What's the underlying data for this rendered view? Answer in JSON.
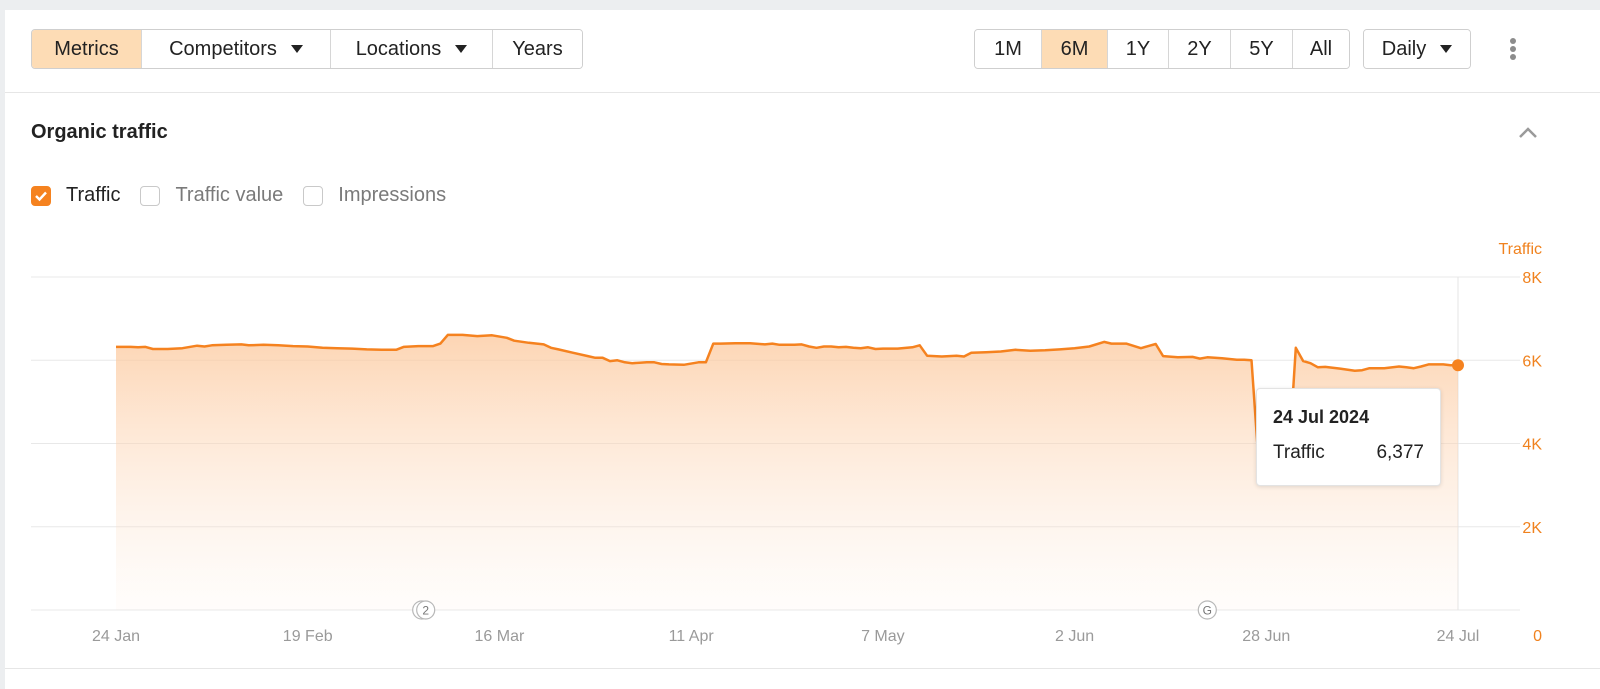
{
  "toolbar": {
    "left_tabs": [
      {
        "label": "Metrics",
        "active": true,
        "dropdown": false
      },
      {
        "label": "Competitors",
        "active": false,
        "dropdown": true
      },
      {
        "label": "Locations",
        "active": false,
        "dropdown": true
      },
      {
        "label": "Years",
        "active": false,
        "dropdown": false
      }
    ],
    "ranges": [
      {
        "label": "1M",
        "active": false
      },
      {
        "label": "6M",
        "active": true
      },
      {
        "label": "1Y",
        "active": false
      },
      {
        "label": "2Y",
        "active": false
      },
      {
        "label": "5Y",
        "active": false
      },
      {
        "label": "All",
        "active": false
      }
    ],
    "granularity": "Daily",
    "more_icon": "kebab-vertical-icon"
  },
  "section": {
    "title": "Organic traffic",
    "collapse_icon": "chevron-up-icon"
  },
  "legend": [
    {
      "label": "Traffic",
      "checked": true
    },
    {
      "label": "Traffic value",
      "checked": false
    },
    {
      "label": "Impressions",
      "checked": false
    }
  ],
  "tooltip": {
    "date": "24 Jul 2024",
    "metric": "Traffic",
    "value": "6,377"
  },
  "colors": {
    "accent": "#f5821f",
    "active_tab": "#fddcb5",
    "axis_label": "#f0821e"
  },
  "chart_data": {
    "type": "area",
    "title": "Organic traffic",
    "ylabel": "Traffic",
    "ylim": [
      0,
      8000
    ],
    "yticks": [
      {
        "value": 8000,
        "label": "8K"
      },
      {
        "value": 6000,
        "label": "6K"
      },
      {
        "value": 4000,
        "label": "4K"
      },
      {
        "value": 2000,
        "label": "2K"
      },
      {
        "value": 0,
        "label": "0"
      }
    ],
    "xrange_days": [
      0,
      182
    ],
    "xticks": [
      {
        "day": 0,
        "label": "24 Jan"
      },
      {
        "day": 26,
        "label": "19 Feb"
      },
      {
        "day": 52,
        "label": "16 Mar"
      },
      {
        "day": 78,
        "label": "11 Apr"
      },
      {
        "day": 104,
        "label": "7 May"
      },
      {
        "day": 130,
        "label": "2 Jun"
      },
      {
        "day": 156,
        "label": "28 Jun"
      },
      {
        "day": 182,
        "label": "24 Jul"
      }
    ],
    "annotations": [
      {
        "day": 42,
        "label": "2",
        "kind": "multiple-events"
      },
      {
        "day": 148,
        "label": "G",
        "kind": "google-update"
      }
    ],
    "grid": true,
    "legend": "top-left",
    "series": [
      {
        "name": "Traffic",
        "points": [
          [
            0,
            6320
          ],
          [
            2,
            6320
          ],
          [
            3,
            6310
          ],
          [
            4,
            6320
          ],
          [
            5,
            6270
          ],
          [
            7,
            6270
          ],
          [
            9,
            6290
          ],
          [
            11,
            6350
          ],
          [
            12,
            6330
          ],
          [
            13,
            6360
          ],
          [
            15,
            6370
          ],
          [
            17,
            6380
          ],
          [
            18,
            6360
          ],
          [
            20,
            6370
          ],
          [
            22,
            6360
          ],
          [
            24,
            6340
          ],
          [
            26,
            6330
          ],
          [
            28,
            6300
          ],
          [
            30,
            6290
          ],
          [
            32,
            6280
          ],
          [
            34,
            6260
          ],
          [
            36,
            6250
          ],
          [
            38,
            6250
          ],
          [
            39,
            6320
          ],
          [
            41,
            6340
          ],
          [
            43,
            6340
          ],
          [
            44,
            6400
          ],
          [
            45,
            6610
          ],
          [
            47,
            6610
          ],
          [
            49,
            6580
          ],
          [
            51,
            6600
          ],
          [
            53,
            6540
          ],
          [
            54,
            6470
          ],
          [
            56,
            6420
          ],
          [
            58,
            6380
          ],
          [
            59,
            6300
          ],
          [
            60,
            6260
          ],
          [
            62,
            6180
          ],
          [
            64,
            6100
          ],
          [
            65,
            6060
          ],
          [
            66,
            6060
          ],
          [
            67,
            5980
          ],
          [
            68,
            6000
          ],
          [
            69,
            5950
          ],
          [
            70,
            5930
          ],
          [
            71,
            5940
          ],
          [
            72,
            5950
          ],
          [
            73,
            5950
          ],
          [
            74,
            5910
          ],
          [
            75,
            5900
          ],
          [
            77,
            5890
          ],
          [
            79,
            5950
          ],
          [
            80,
            5950
          ],
          [
            81,
            6400
          ],
          [
            82,
            6400
          ],
          [
            84,
            6410
          ],
          [
            86,
            6410
          ],
          [
            88,
            6380
          ],
          [
            89,
            6400
          ],
          [
            90,
            6370
          ],
          [
            92,
            6370
          ],
          [
            93,
            6380
          ],
          [
            94,
            6330
          ],
          [
            95,
            6300
          ],
          [
            96,
            6330
          ],
          [
            97,
            6330
          ],
          [
            98,
            6310
          ],
          [
            99,
            6320
          ],
          [
            100,
            6300
          ],
          [
            101,
            6290
          ],
          [
            102,
            6310
          ],
          [
            103,
            6270
          ],
          [
            104,
            6280
          ],
          [
            106,
            6280
          ],
          [
            108,
            6310
          ],
          [
            109,
            6360
          ],
          [
            110,
            6110
          ],
          [
            112,
            6090
          ],
          [
            114,
            6110
          ],
          [
            115,
            6090
          ],
          [
            116,
            6180
          ],
          [
            118,
            6190
          ],
          [
            120,
            6210
          ],
          [
            122,
            6250
          ],
          [
            124,
            6230
          ],
          [
            126,
            6240
          ],
          [
            128,
            6260
          ],
          [
            130,
            6290
          ],
          [
            132,
            6330
          ],
          [
            134,
            6440
          ],
          [
            135,
            6400
          ],
          [
            137,
            6400
          ],
          [
            139,
            6290
          ],
          [
            140,
            6340
          ],
          [
            141,
            6390
          ],
          [
            142,
            6100
          ],
          [
            144,
            6070
          ],
          [
            146,
            6080
          ],
          [
            147,
            6040
          ],
          [
            148,
            6070
          ],
          [
            150,
            6050
          ],
          [
            152,
            6010
          ],
          [
            153,
            6010
          ],
          [
            154,
            6000
          ],
          [
            155,
            3450
          ],
          [
            156,
            3460
          ],
          [
            157,
            3400
          ],
          [
            158,
            3480
          ],
          [
            159,
            3470
          ],
          [
            160,
            6300
          ],
          [
            161,
            5980
          ],
          [
            162,
            5930
          ],
          [
            163,
            5830
          ],
          [
            164,
            5840
          ],
          [
            166,
            5800
          ],
          [
            168,
            5750
          ],
          [
            169,
            5760
          ],
          [
            170,
            5810
          ],
          [
            172,
            5810
          ],
          [
            174,
            5850
          ],
          [
            175,
            5830
          ],
          [
            176,
            5810
          ],
          [
            177,
            5850
          ],
          [
            178,
            5900
          ],
          [
            179,
            5900
          ],
          [
            180,
            5900
          ],
          [
            181,
            5880
          ],
          [
            182,
            5880
          ]
        ]
      }
    ]
  }
}
